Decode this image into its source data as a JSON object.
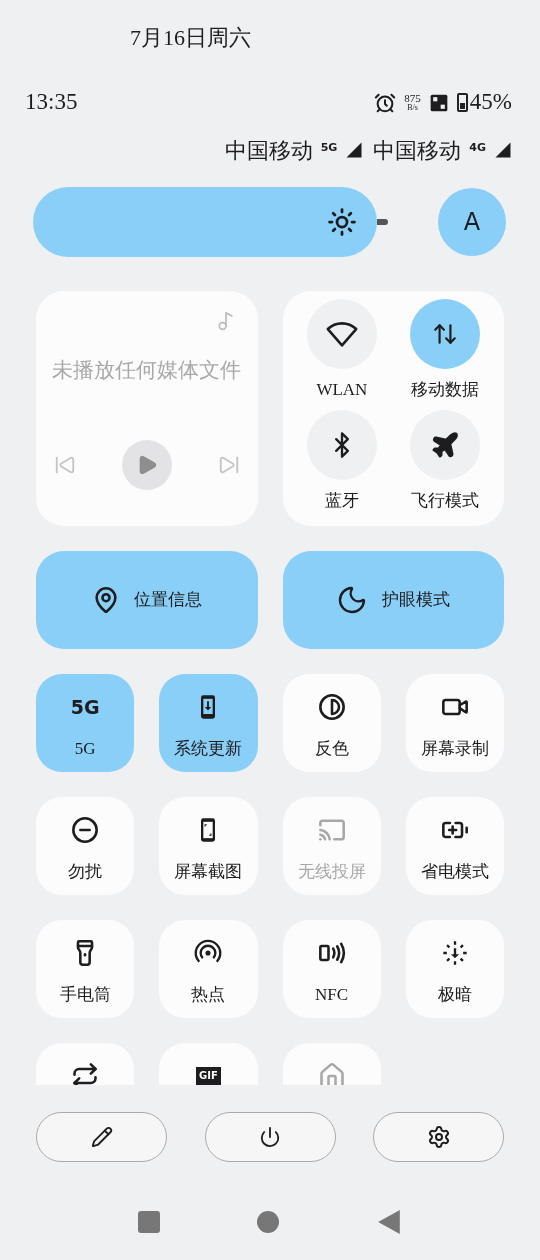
{
  "date": "7月16日周六",
  "status_bar": {
    "time": "13:35",
    "speed": "875",
    "speed_unit": "B/s",
    "battery": "45%"
  },
  "carriers": [
    {
      "name": "中国移动",
      "network": "5G"
    },
    {
      "name": "中国移动",
      "network": "4G"
    }
  ],
  "brightness": {
    "level": 0.97,
    "auto": {
      "label": "A",
      "selected": true
    }
  },
  "media": {
    "message": "未播放任何媒体文件",
    "disabled": true
  },
  "connectivity": [
    {
      "label": "WLAN",
      "on": false
    },
    {
      "label": "移动数据",
      "on": true
    },
    {
      "label": "蓝牙",
      "on": false
    },
    {
      "label": "飞行模式",
      "on": false
    }
  ],
  "large_tiles": [
    {
      "label": "位置信息",
      "on": true
    },
    {
      "label": "护眼模式",
      "on": true
    }
  ],
  "tiles": [
    {
      "label": "5G",
      "icon_text": "5G",
      "on": true,
      "disabled": false
    },
    {
      "label": "系统更新",
      "on": true,
      "disabled": false
    },
    {
      "label": "反色",
      "on": false,
      "disabled": false
    },
    {
      "label": "屏幕录制",
      "on": false,
      "disabled": false
    },
    {
      "label": "勿扰",
      "on": false,
      "disabled": false
    },
    {
      "label": "屏幕截图",
      "on": false,
      "disabled": false
    },
    {
      "label": "无线投屏",
      "on": false,
      "disabled": true
    },
    {
      "label": "省电模式",
      "on": false,
      "disabled": false
    },
    {
      "label": "手电筒",
      "on": false,
      "disabled": false
    },
    {
      "label": "热点",
      "on": false,
      "disabled": false
    },
    {
      "label": "NFC",
      "on": false,
      "disabled": false
    },
    {
      "label": "极暗",
      "on": false,
      "disabled": false
    },
    {
      "on": false,
      "disabled": false
    },
    {
      "icon_text": "GIF",
      "on": false,
      "disabled": false
    },
    {
      "on": false,
      "disabled": true
    }
  ]
}
